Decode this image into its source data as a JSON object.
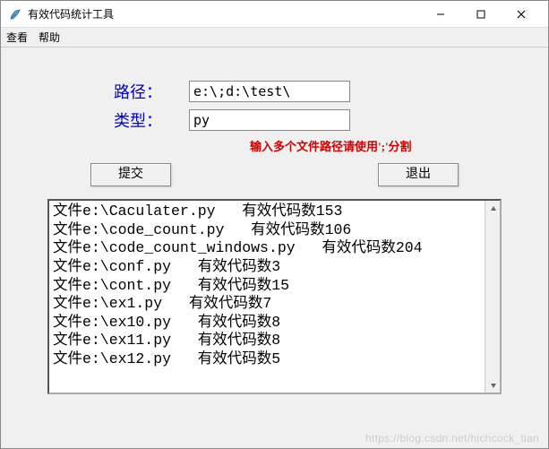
{
  "window": {
    "title": "有效代码统计工具"
  },
  "menu": {
    "view": "查看",
    "help": "帮助"
  },
  "form": {
    "path_label": "路径：",
    "path_value": "e:\\;d:\\test\\",
    "type_label": "类型：",
    "type_value": "py",
    "hint": "输入多个文件路径请使用';'分割"
  },
  "buttons": {
    "submit": "提交",
    "exit": "退出"
  },
  "output_lines": [
    "文件e:\\Caculater.py   有效代码数153",
    "文件e:\\code_count.py   有效代码数106",
    "文件e:\\code_count_windows.py   有效代码数204",
    "文件e:\\conf.py   有效代码数3",
    "文件e:\\cont.py   有效代码数15",
    "文件e:\\ex1.py   有效代码数7",
    "文件e:\\ex10.py   有效代码数8",
    "文件e:\\ex11.py   有效代码数8",
    "文件e:\\ex12.py   有效代码数5"
  ],
  "watermark": "https://blog.csdn.net/hichcock_tian"
}
